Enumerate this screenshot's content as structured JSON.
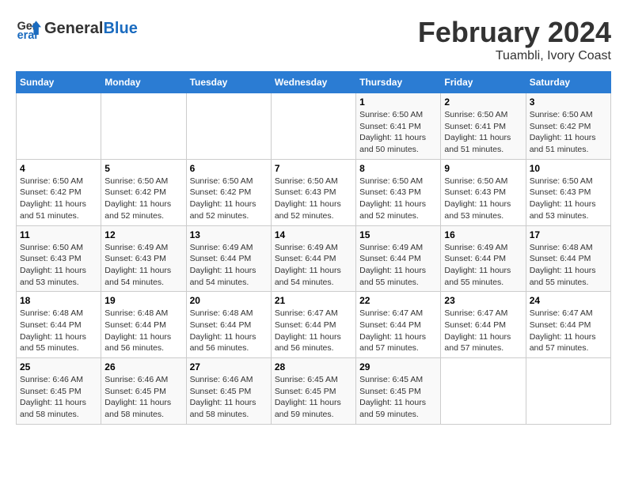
{
  "header": {
    "logo_general": "General",
    "logo_blue": "Blue",
    "title": "February 2024",
    "subtitle": "Tuambli, Ivory Coast"
  },
  "calendar": {
    "days_of_week": [
      "Sunday",
      "Monday",
      "Tuesday",
      "Wednesday",
      "Thursday",
      "Friday",
      "Saturday"
    ],
    "weeks": [
      [
        {
          "day": "",
          "info": ""
        },
        {
          "day": "",
          "info": ""
        },
        {
          "day": "",
          "info": ""
        },
        {
          "day": "",
          "info": ""
        },
        {
          "day": "1",
          "info": "Sunrise: 6:50 AM\nSunset: 6:41 PM\nDaylight: 11 hours and 50 minutes."
        },
        {
          "day": "2",
          "info": "Sunrise: 6:50 AM\nSunset: 6:41 PM\nDaylight: 11 hours and 51 minutes."
        },
        {
          "day": "3",
          "info": "Sunrise: 6:50 AM\nSunset: 6:42 PM\nDaylight: 11 hours and 51 minutes."
        }
      ],
      [
        {
          "day": "4",
          "info": "Sunrise: 6:50 AM\nSunset: 6:42 PM\nDaylight: 11 hours and 51 minutes."
        },
        {
          "day": "5",
          "info": "Sunrise: 6:50 AM\nSunset: 6:42 PM\nDaylight: 11 hours and 52 minutes."
        },
        {
          "day": "6",
          "info": "Sunrise: 6:50 AM\nSunset: 6:42 PM\nDaylight: 11 hours and 52 minutes."
        },
        {
          "day": "7",
          "info": "Sunrise: 6:50 AM\nSunset: 6:43 PM\nDaylight: 11 hours and 52 minutes."
        },
        {
          "day": "8",
          "info": "Sunrise: 6:50 AM\nSunset: 6:43 PM\nDaylight: 11 hours and 52 minutes."
        },
        {
          "day": "9",
          "info": "Sunrise: 6:50 AM\nSunset: 6:43 PM\nDaylight: 11 hours and 53 minutes."
        },
        {
          "day": "10",
          "info": "Sunrise: 6:50 AM\nSunset: 6:43 PM\nDaylight: 11 hours and 53 minutes."
        }
      ],
      [
        {
          "day": "11",
          "info": "Sunrise: 6:50 AM\nSunset: 6:43 PM\nDaylight: 11 hours and 53 minutes."
        },
        {
          "day": "12",
          "info": "Sunrise: 6:49 AM\nSunset: 6:43 PM\nDaylight: 11 hours and 54 minutes."
        },
        {
          "day": "13",
          "info": "Sunrise: 6:49 AM\nSunset: 6:44 PM\nDaylight: 11 hours and 54 minutes."
        },
        {
          "day": "14",
          "info": "Sunrise: 6:49 AM\nSunset: 6:44 PM\nDaylight: 11 hours and 54 minutes."
        },
        {
          "day": "15",
          "info": "Sunrise: 6:49 AM\nSunset: 6:44 PM\nDaylight: 11 hours and 55 minutes."
        },
        {
          "day": "16",
          "info": "Sunrise: 6:49 AM\nSunset: 6:44 PM\nDaylight: 11 hours and 55 minutes."
        },
        {
          "day": "17",
          "info": "Sunrise: 6:48 AM\nSunset: 6:44 PM\nDaylight: 11 hours and 55 minutes."
        }
      ],
      [
        {
          "day": "18",
          "info": "Sunrise: 6:48 AM\nSunset: 6:44 PM\nDaylight: 11 hours and 55 minutes."
        },
        {
          "day": "19",
          "info": "Sunrise: 6:48 AM\nSunset: 6:44 PM\nDaylight: 11 hours and 56 minutes."
        },
        {
          "day": "20",
          "info": "Sunrise: 6:48 AM\nSunset: 6:44 PM\nDaylight: 11 hours and 56 minutes."
        },
        {
          "day": "21",
          "info": "Sunrise: 6:47 AM\nSunset: 6:44 PM\nDaylight: 11 hours and 56 minutes."
        },
        {
          "day": "22",
          "info": "Sunrise: 6:47 AM\nSunset: 6:44 PM\nDaylight: 11 hours and 57 minutes."
        },
        {
          "day": "23",
          "info": "Sunrise: 6:47 AM\nSunset: 6:44 PM\nDaylight: 11 hours and 57 minutes."
        },
        {
          "day": "24",
          "info": "Sunrise: 6:47 AM\nSunset: 6:44 PM\nDaylight: 11 hours and 57 minutes."
        }
      ],
      [
        {
          "day": "25",
          "info": "Sunrise: 6:46 AM\nSunset: 6:45 PM\nDaylight: 11 hours and 58 minutes."
        },
        {
          "day": "26",
          "info": "Sunrise: 6:46 AM\nSunset: 6:45 PM\nDaylight: 11 hours and 58 minutes."
        },
        {
          "day": "27",
          "info": "Sunrise: 6:46 AM\nSunset: 6:45 PM\nDaylight: 11 hours and 58 minutes."
        },
        {
          "day": "28",
          "info": "Sunrise: 6:45 AM\nSunset: 6:45 PM\nDaylight: 11 hours and 59 minutes."
        },
        {
          "day": "29",
          "info": "Sunrise: 6:45 AM\nSunset: 6:45 PM\nDaylight: 11 hours and 59 minutes."
        },
        {
          "day": "",
          "info": ""
        },
        {
          "day": "",
          "info": ""
        }
      ]
    ]
  }
}
